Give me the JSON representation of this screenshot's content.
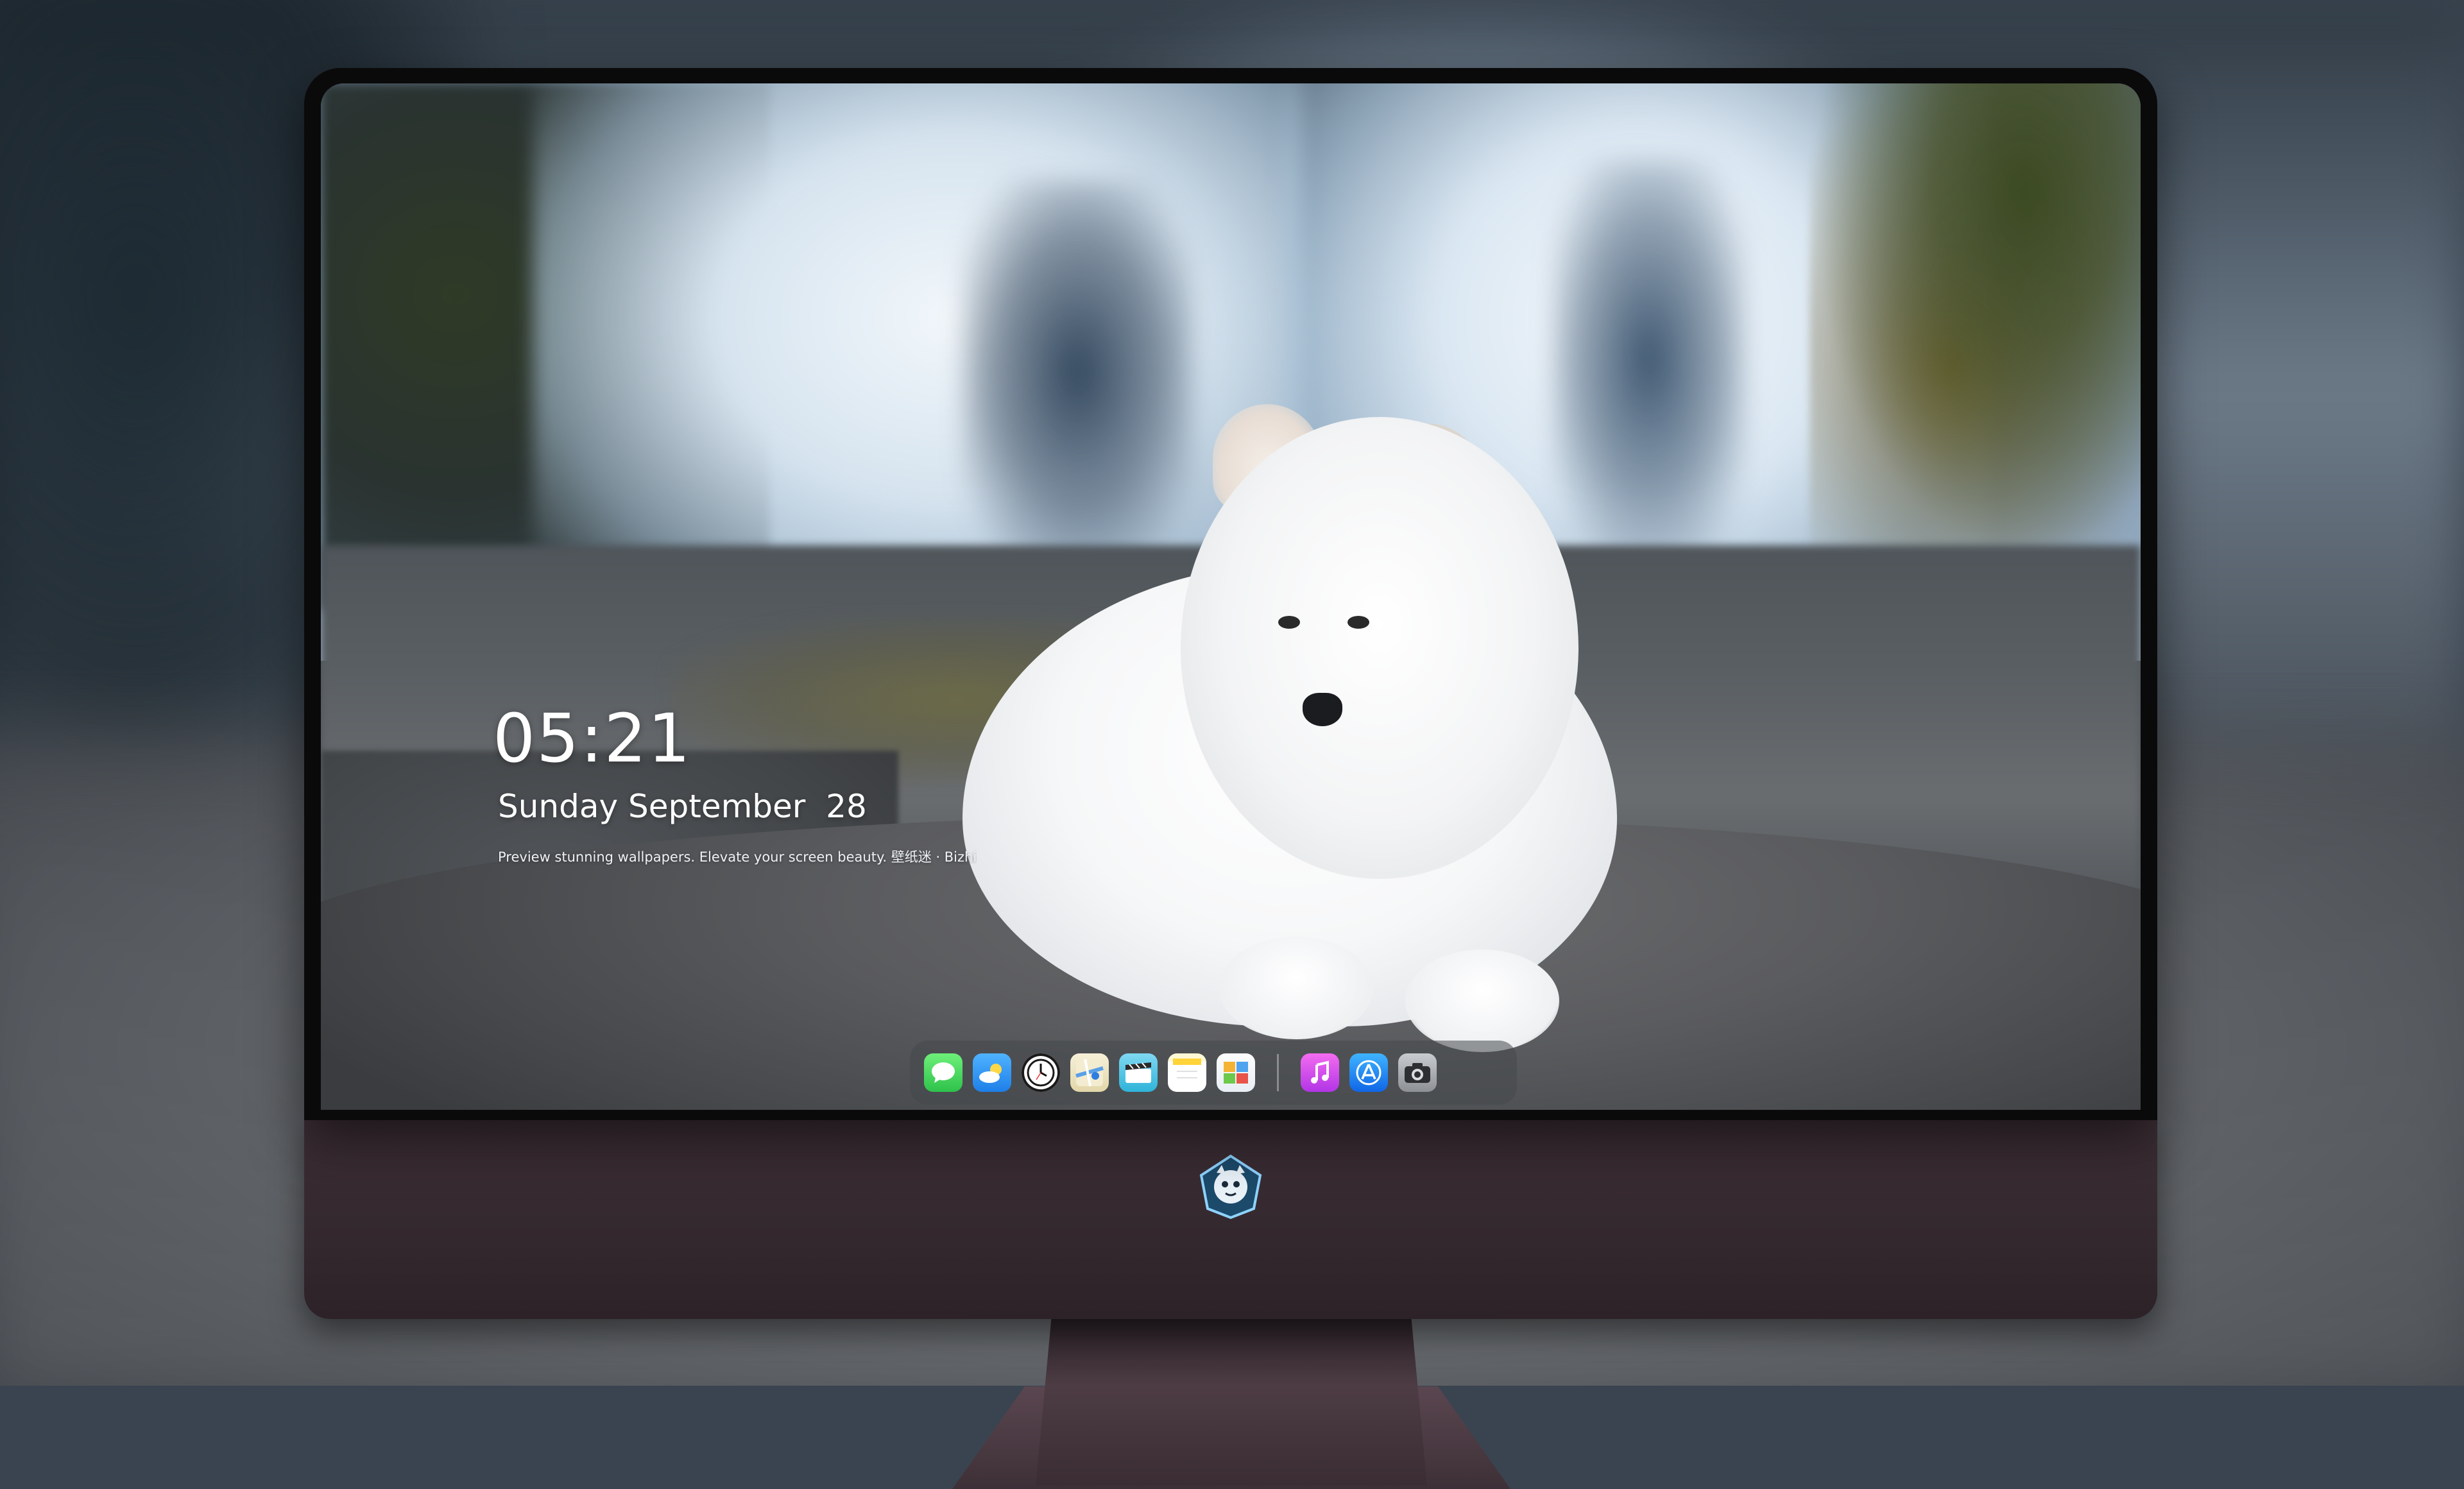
{
  "lockscreen": {
    "time": "05:21",
    "date": "Sunday September  28",
    "tagline": "Preview stunning wallpapers. Elevate your screen beauty. 壁纸迷 · Bizhi"
  },
  "dock": {
    "apps": [
      {
        "name": "Messages",
        "icon": "messages-icon"
      },
      {
        "name": "Weather",
        "icon": "weather-icon"
      },
      {
        "name": "Clock",
        "icon": "clock-icon"
      },
      {
        "name": "Maps",
        "icon": "maps-icon"
      },
      {
        "name": "Clips",
        "icon": "clips-icon"
      },
      {
        "name": "Notes",
        "icon": "notes-icon"
      },
      {
        "name": "Photos",
        "icon": "photos-icon"
      },
      {
        "name": "Music",
        "icon": "music-icon"
      },
      {
        "name": "App Store",
        "icon": "app-store-icon"
      },
      {
        "name": "Camera",
        "icon": "camera-icon"
      }
    ]
  },
  "colors": {
    "bezel": "#0a0a0b",
    "chin": "#3d2f36",
    "text": "#ffffff"
  }
}
